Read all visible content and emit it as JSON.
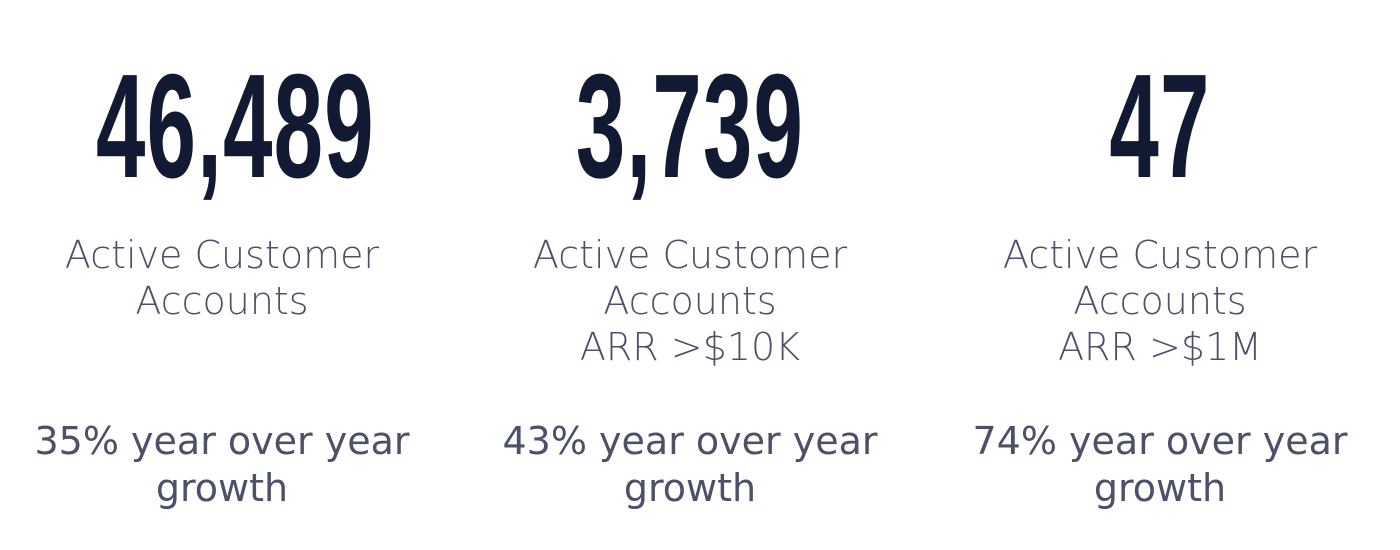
{
  "stats": [
    {
      "value": "46,489",
      "label_lines": [
        "Active Customer",
        "Accounts"
      ],
      "growth_lines": [
        "35% year over year",
        "growth"
      ]
    },
    {
      "value": "3,739",
      "label_lines": [
        "Active Customer",
        "Accounts",
        "ARR >$10K"
      ],
      "growth_lines": [
        "43% year over year",
        "growth"
      ]
    },
    {
      "value": "47",
      "label_lines": [
        "Active Customer",
        "Accounts",
        "ARR >$1M"
      ],
      "growth_lines": [
        "74% year over year",
        "growth"
      ]
    }
  ],
  "colors": {
    "value_text": "#121a33",
    "label_text": "#4c5068",
    "background": "#ffffff"
  }
}
